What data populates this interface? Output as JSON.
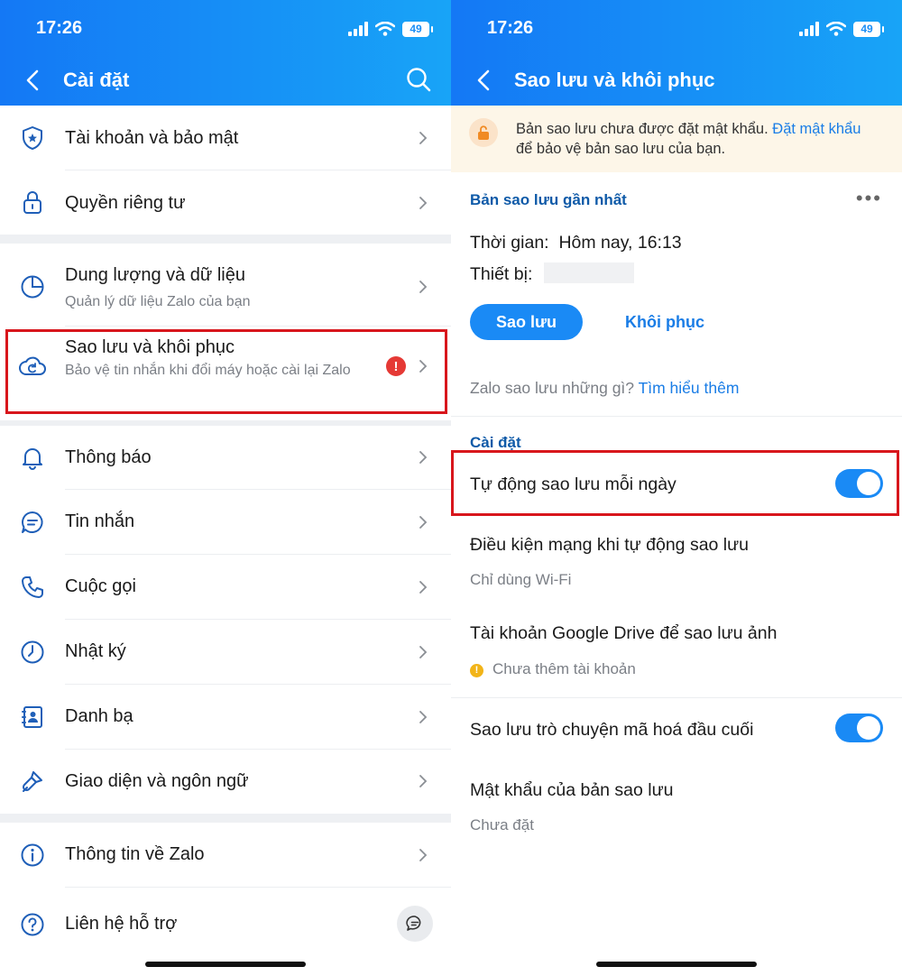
{
  "status_bar": {
    "time": "17:26",
    "battery": "49"
  },
  "left": {
    "header": {
      "title": "Cài đặt"
    },
    "items": [
      {
        "label": "Tài khoản và bảo mật",
        "icon": "shield-icon"
      },
      {
        "label": "Quyền riêng tư",
        "icon": "lock-icon"
      },
      {
        "label": "Dung lượng và dữ liệu",
        "sub": "Quản lý dữ liệu Zalo của bạn",
        "icon": "pie-chart-icon"
      },
      {
        "label": "Sao lưu và khôi phục",
        "sub": "Bảo vệ tin nhắn khi đổi máy hoặc cài lại Zalo",
        "icon": "cloud-backup-icon",
        "alert": "!"
      },
      {
        "label": "Thông báo",
        "icon": "bell-icon"
      },
      {
        "label": "Tin nhắn",
        "icon": "chat-icon"
      },
      {
        "label": "Cuộc gọi",
        "icon": "phone-icon"
      },
      {
        "label": "Nhật ký",
        "icon": "clock-icon"
      },
      {
        "label": "Danh bạ",
        "icon": "contacts-icon"
      },
      {
        "label": "Giao diện và ngôn ngữ",
        "icon": "brush-icon"
      },
      {
        "label": "Thông tin về Zalo",
        "icon": "info-icon"
      },
      {
        "label": "Liên hệ hỗ trợ",
        "icon": "help-icon"
      }
    ]
  },
  "right": {
    "header": {
      "title": "Sao lưu và khôi phục"
    },
    "notice": {
      "text_before": "Bản sao lưu chưa được đặt mật khẩu. ",
      "link": "Đặt mật khẩu",
      "text_after": " để bảo vệ bản sao lưu của bạn."
    },
    "latest_backup": {
      "title": "Bản sao lưu gần nhất",
      "time_label": "Thời gian:",
      "time_value": "Hôm nay, 16:13",
      "device_label": "Thiết bị:",
      "backup_button": "Sao lưu",
      "restore_button": "Khôi phục",
      "what_text": "Zalo sao lưu những gì?",
      "learn_more": "Tìm hiểu thêm"
    },
    "settings": {
      "title": "Cài đặt",
      "auto_backup": {
        "label": "Tự động sao lưu mỗi ngày",
        "on": true
      },
      "network": {
        "label": "Điều kiện mạng khi tự động sao lưu",
        "value": "Chỉ dùng Wi-Fi"
      },
      "google_drive": {
        "label": "Tài khoản Google Drive để sao lưu ảnh",
        "value": "Chưa thêm tài khoản"
      },
      "e2ee": {
        "label": "Sao lưu trò chuyện mã hoá đầu cuối",
        "on": true
      },
      "password": {
        "label": "Mật khẩu của bản sao lưu",
        "value": "Chưa đặt"
      }
    }
  },
  "colors": {
    "accent": "#1a8af5",
    "header_start": "#1478f5",
    "header_end": "#18a4f7",
    "highlight": "#d8161c",
    "section_title": "#0e5aa8"
  }
}
